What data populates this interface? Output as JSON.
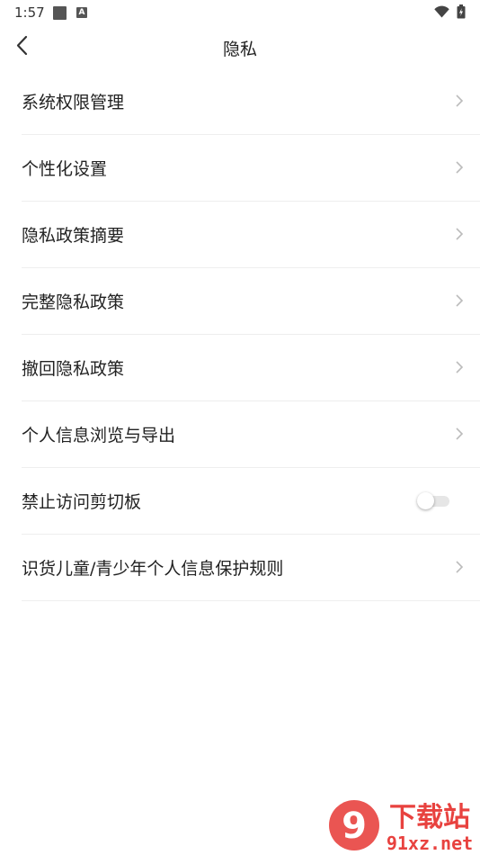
{
  "status_bar": {
    "time": "1:57",
    "notification_a": "A"
  },
  "header": {
    "title": "隐私"
  },
  "menu": {
    "items": [
      {
        "label": "系统权限管理",
        "control": "chevron"
      },
      {
        "label": "个性化设置",
        "control": "chevron"
      },
      {
        "label": "隐私政策摘要",
        "control": "chevron"
      },
      {
        "label": "完整隐私政策",
        "control": "chevron"
      },
      {
        "label": "撤回隐私政策",
        "control": "chevron"
      },
      {
        "label": "个人信息浏览与导出",
        "control": "chevron"
      },
      {
        "label": "禁止访问剪切板",
        "control": "toggle",
        "toggle_on": false
      },
      {
        "label": "识货儿童/青少年个人信息保护规则",
        "control": "chevron"
      }
    ]
  },
  "watermark": {
    "title": "下载站",
    "site": "91xz.net",
    "logo_glyph": "9"
  },
  "colors": {
    "text": "#222222",
    "divider": "#eeeeee",
    "chevron": "#bbbbbb",
    "watermark_red": "#e8423f"
  },
  "icons": {
    "back": "chevron-left-icon",
    "row_arrow": "chevron-right-icon",
    "wifi": "wifi-icon",
    "battery": "battery-icon"
  }
}
